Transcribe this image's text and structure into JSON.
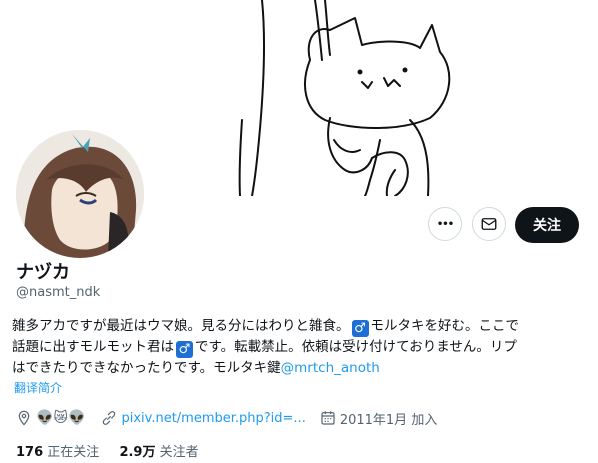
{
  "profile": {
    "name": "ナヅカ",
    "handle": "@nasmt_ndk",
    "bio_line1_a": "雑多アカですが最近はウマ娘。見る分にはわりと雑食。",
    "bio_male1": "♂",
    "bio_line1_b": "モルタキを好む。ここで",
    "bio_line2_a": "話題に出すモルモット君は",
    "bio_male2": "♂",
    "bio_line2_b": "です。転載禁止。依頼は受け付けておりません。リプ",
    "bio_line3_a": "はできたりできなかったりです。モルタキ鍵",
    "bio_link": "@mrtch_anoth",
    "translate_label": "翻译简介",
    "location_emojis": "👽😿👽",
    "website": "pixiv.net/member.php?id=...",
    "joined": "2011年1月 加入",
    "following_count": "176",
    "following_label": "正在关注",
    "followers_count": "2.9万",
    "followers_label": "关注者"
  },
  "actions": {
    "more_label": "•••",
    "follow_label": "关注"
  },
  "icons": [
    "more-icon",
    "mail-icon",
    "location-icon",
    "link-icon",
    "calendar-icon"
  ]
}
